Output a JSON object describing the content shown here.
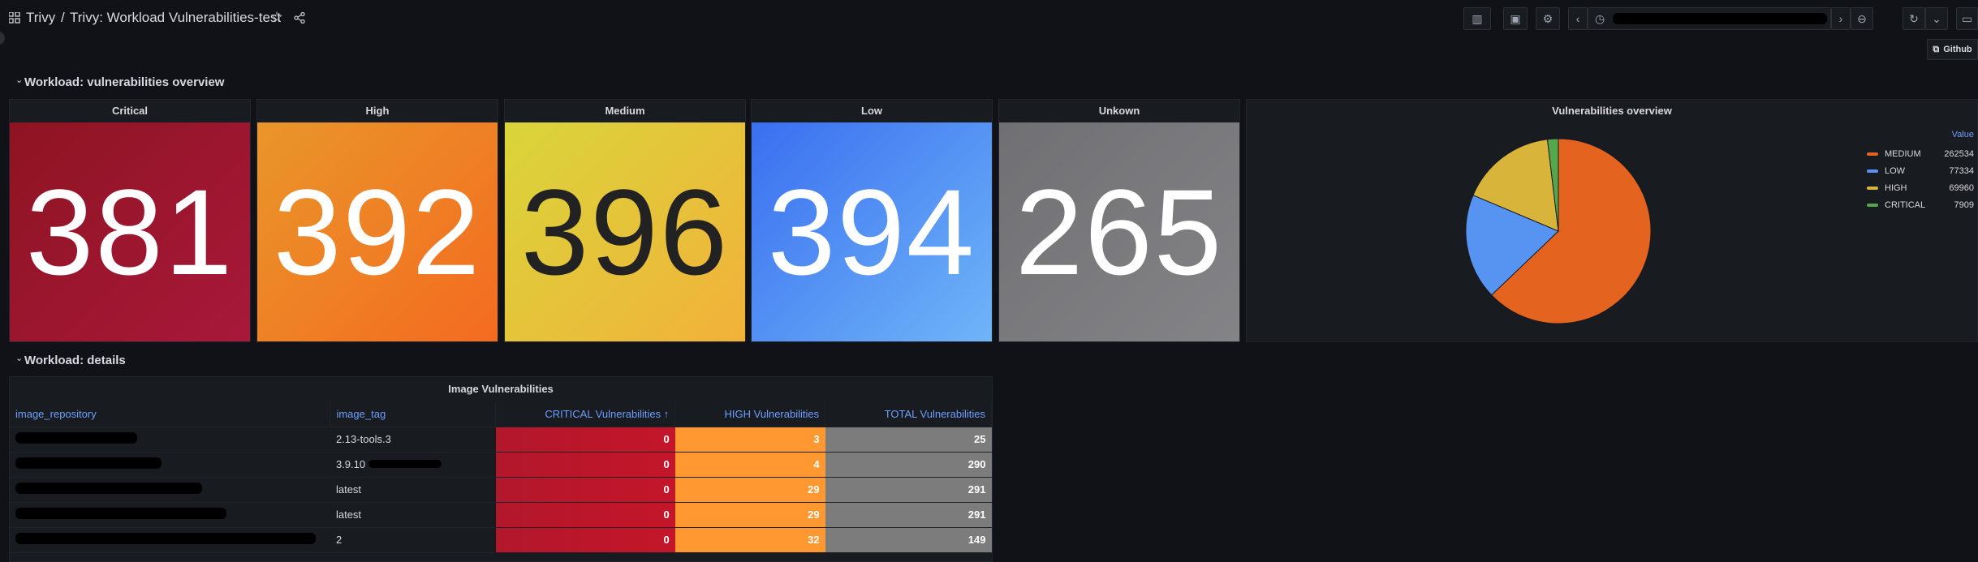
{
  "breadcrumb": {
    "root": "Trivy",
    "separator": "/",
    "dashboard": "Trivy: Workload Vulnerabilities-test"
  },
  "toolbar": {
    "github_link": "Github"
  },
  "rows": {
    "overview": "Workload: vulnerabilities overview",
    "details": "Workload: details"
  },
  "stats": [
    {
      "title": "Critical",
      "value": "381",
      "color": "#a31631"
    },
    {
      "title": "High",
      "value": "392",
      "color": "#f2852a"
    },
    {
      "title": "Medium",
      "value": "396",
      "color": "#eac339"
    },
    {
      "title": "Low",
      "value": "394",
      "color": "#5794f2"
    },
    {
      "title": "Unkown",
      "value": "265",
      "color": "#7a7a7d"
    }
  ],
  "pie": {
    "title": "Vulnerabilities overview",
    "legend_header": "Value",
    "slices": [
      {
        "label": "MEDIUM",
        "value": 262534,
        "display": "262534",
        "color": "#e3631f"
      },
      {
        "label": "LOW",
        "value": 77334,
        "display": "77334",
        "color": "#5794f2"
      },
      {
        "label": "HIGH",
        "value": 69960,
        "display": "69960",
        "color": "#d9b43a"
      },
      {
        "label": "CRITICAL",
        "value": 7909,
        "display": "7909",
        "color": "#56a64b"
      }
    ]
  },
  "table": {
    "title": "Image Vulnerabilities",
    "columns": [
      "image_repository",
      "image_tag",
      "CRITICAL Vulnerabilities ↑",
      "HIGH Vulnerabilities",
      "TOTAL Vulnerabilities"
    ],
    "rows": [
      {
        "tag": "2.13-tools.3",
        "critical": "0",
        "high": "3",
        "total": "25"
      },
      {
        "tag": "3.9.10",
        "critical": "0",
        "high": "4",
        "total": "290"
      },
      {
        "tag": "latest",
        "critical": "0",
        "high": "29",
        "total": "291"
      },
      {
        "tag": "latest",
        "critical": "0",
        "high": "29",
        "total": "291"
      },
      {
        "tag": "2",
        "critical": "0",
        "high": "32",
        "total": "149"
      }
    ]
  }
}
